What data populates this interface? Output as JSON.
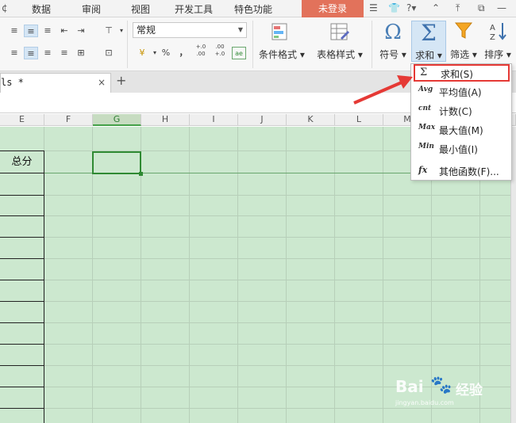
{
  "menubar": {
    "items": [
      "数据",
      "审阅",
      "视图",
      "开发工具",
      "特色功能"
    ],
    "login_label": "未登录",
    "help_label": "?"
  },
  "ribbon": {
    "number_format": "常规",
    "percent_symbol": "%",
    "comma_symbol": "，",
    "inc_decimal": "+.0 .00",
    "dec_decimal": ".00 +.0",
    "buttons": {
      "conditional_format": "条件格式",
      "table_style": "表格样式",
      "symbol": "符号",
      "sum": "求和",
      "filter": "筛选",
      "sort": "排序"
    }
  },
  "tabs": {
    "doc_tab": "ls *",
    "close": "×",
    "add": "+"
  },
  "columns": [
    "E",
    "F",
    "G",
    "H",
    "I",
    "J",
    "K",
    "L",
    "M"
  ],
  "sheet": {
    "header_cell": "总分"
  },
  "dropdown": {
    "items": [
      {
        "icon": "Σ",
        "label": "求和(S)"
      },
      {
        "icon": "Avg",
        "label": "平均值(A)"
      },
      {
        "icon": "cnt",
        "label": "计数(C)"
      },
      {
        "icon": "Max",
        "label": "最大值(M)"
      },
      {
        "icon": "Min",
        "label": "最小值(I)"
      },
      {
        "icon": "fx",
        "label": "其他函数(F)..."
      }
    ]
  },
  "watermark": {
    "brand": "Bai",
    "cn": "经验",
    "url": "jingyan.baidu.com"
  },
  "colors": {
    "sheet_bg": "#cce8cf",
    "accent_green": "#2f8a33",
    "highlight_red": "#e53935",
    "login_bg": "#e2725b"
  }
}
